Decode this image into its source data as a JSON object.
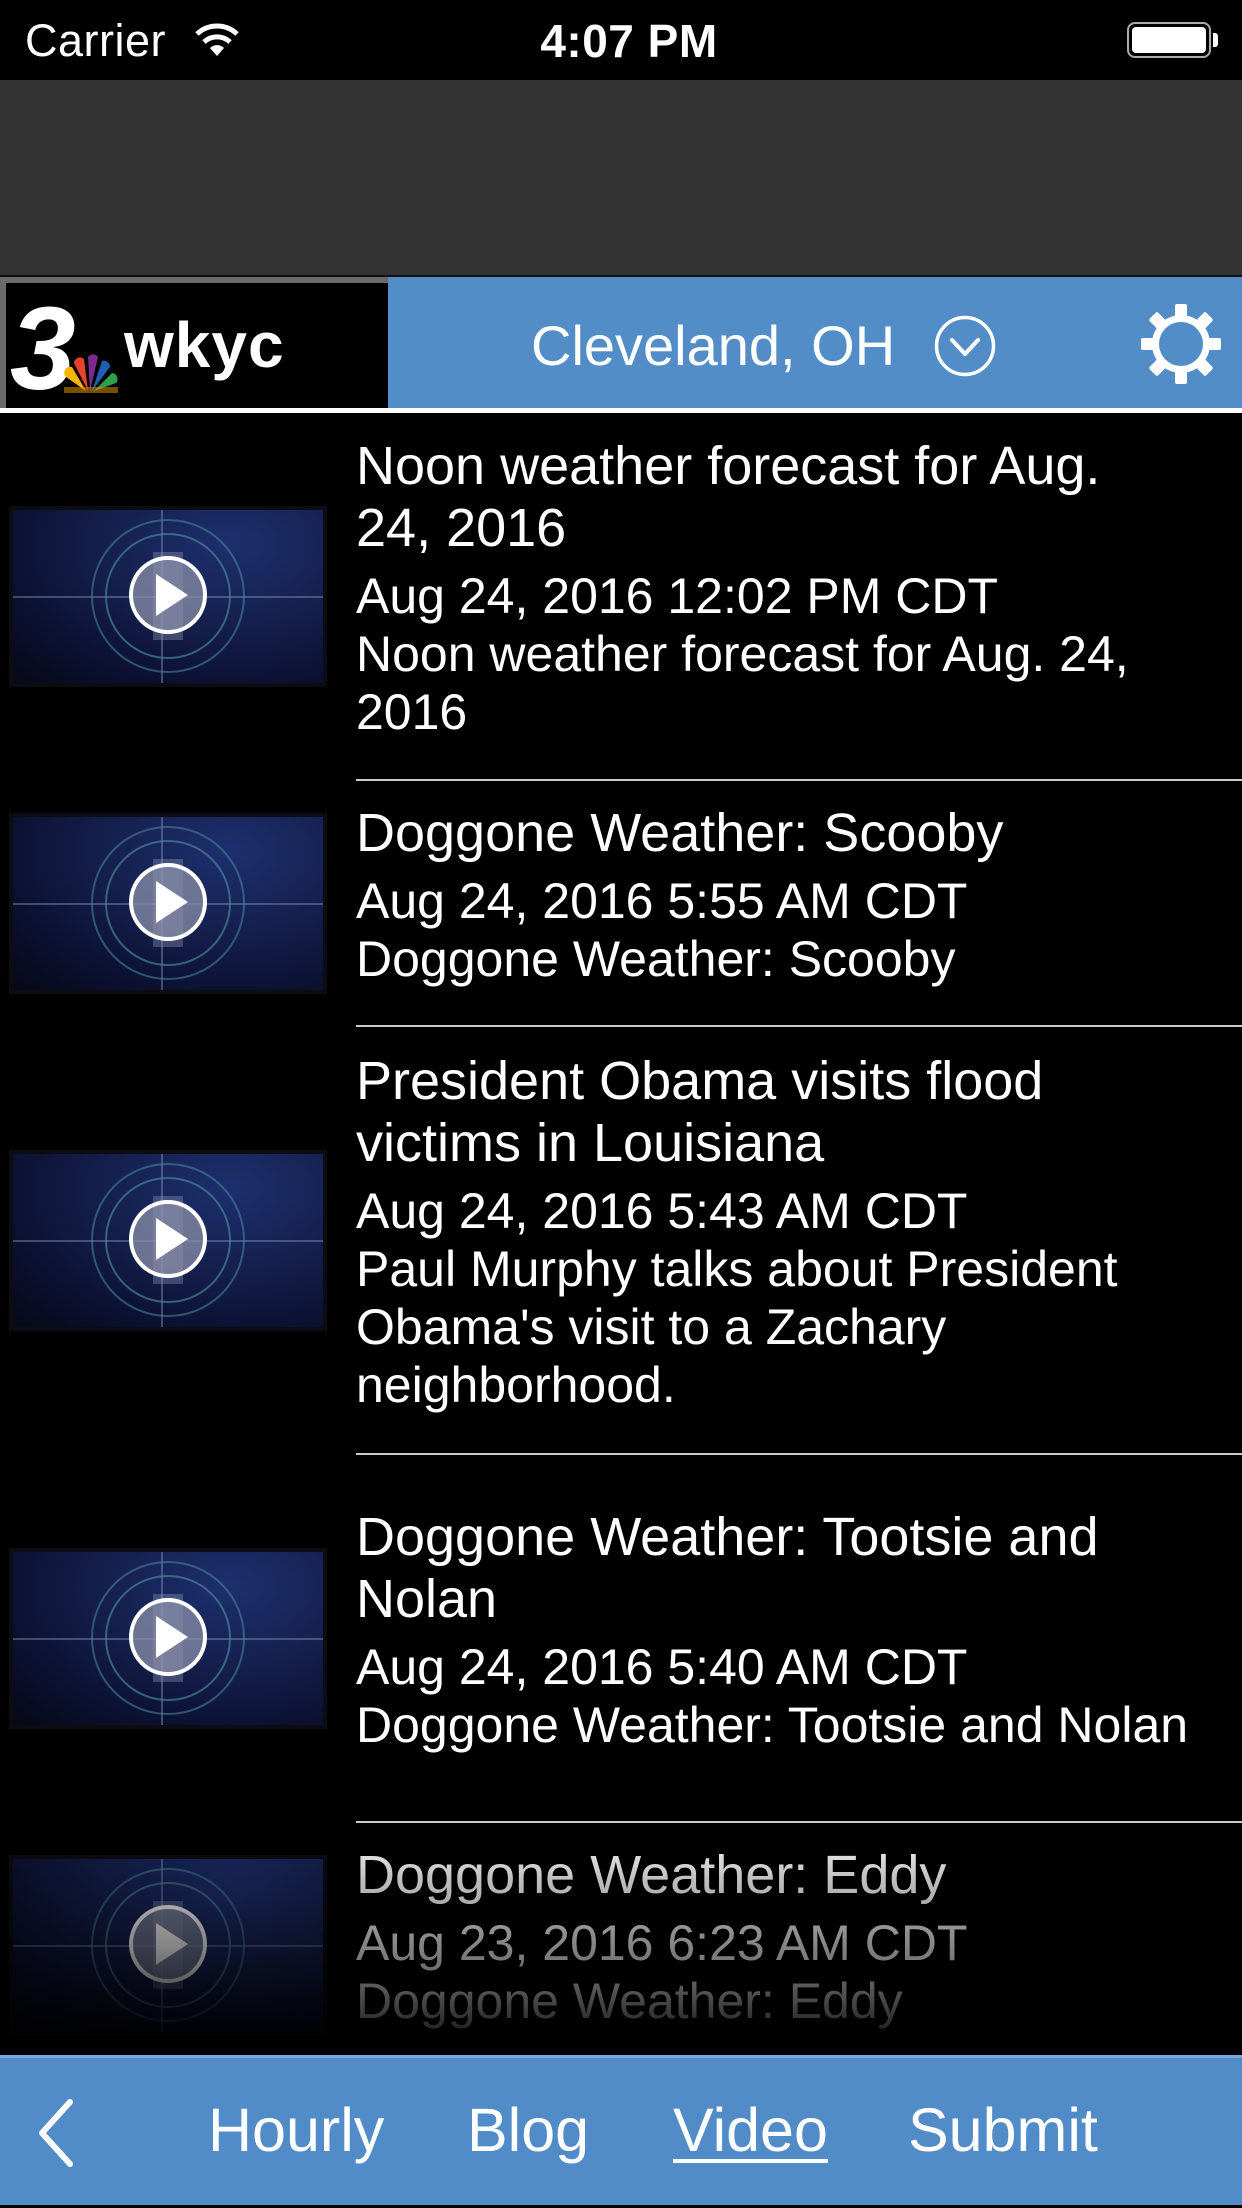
{
  "status_bar": {
    "carrier": "Carrier",
    "time": "4:07 PM",
    "wifi_icon": "wifi-icon",
    "battery_icon": "battery-full-icon",
    "battery_level_percent": 100
  },
  "header": {
    "logo_text": "wkyc",
    "logo_number": "3",
    "location": "Cleveland, OH",
    "location_dropdown_icon": "chevron-down-circle-icon",
    "settings_icon": "gear-icon",
    "colors": {
      "bar": "#538dc8",
      "logo_bg": "#000000",
      "ad_band": "#333333"
    }
  },
  "videos": [
    {
      "title": "Noon weather forecast for Aug. 24, 2016",
      "date": "Aug 24, 2016 12:02 PM CDT",
      "description": "Noon weather forecast for Aug. 24, 2016",
      "thumbnail_icon": "play-icon"
    },
    {
      "title": "Doggone Weather: Scooby",
      "date": "Aug 24, 2016 5:55 AM CDT",
      "description": "Doggone Weather: Scooby",
      "thumbnail_icon": "play-icon"
    },
    {
      "title": "President Obama visits flood victims in Louisiana",
      "date": "Aug 24, 2016 5:43 AM CDT",
      "description": "Paul Murphy talks about President Obama's visit to a Zachary neighborhood.",
      "thumbnail_icon": "play-icon"
    },
    {
      "title": "Doggone Weather: Tootsie and Nolan",
      "date": "Aug 24, 2016 5:40 AM CDT",
      "description": "Doggone Weather: Tootsie and Nolan",
      "thumbnail_icon": "play-icon"
    },
    {
      "title": "Doggone Weather: Eddy",
      "date": "Aug 23, 2016 6:23 AM CDT",
      "description": "Doggone Weather: Eddy",
      "thumbnail_icon": "play-icon"
    }
  ],
  "tab_bar": {
    "back_icon": "chevron-left-icon",
    "tabs": [
      {
        "label": "Hourly",
        "active": false
      },
      {
        "label": "Blog",
        "active": false
      },
      {
        "label": "Video",
        "active": true
      },
      {
        "label": "Submit",
        "active": false
      }
    ],
    "colors": {
      "bar": "#528cc8",
      "text": "#ffffff"
    }
  }
}
